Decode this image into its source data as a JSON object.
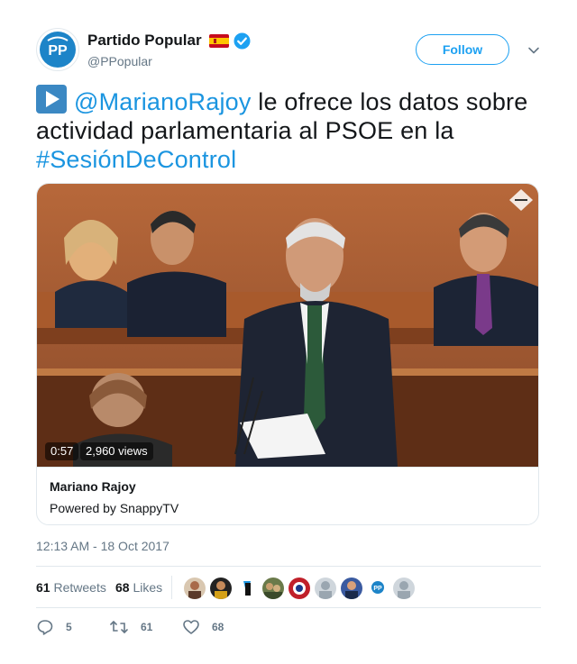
{
  "user": {
    "display_name": "Partido Popular",
    "handle": "@PPopular",
    "avatar_icon": "pp-logo-icon",
    "flag_icon": "spain-flag-icon",
    "verified_icon": "verified-badge-icon"
  },
  "header": {
    "follow_label": "Follow",
    "menu_icon": "chevron-down-icon"
  },
  "tweet": {
    "emoji_icon": "play-button-emoji",
    "mention": "@MarianoRajoy",
    "text_middle": " le ofrece los datos sobre actividad parlamentaria al PSOE en la ",
    "hashtag": "#SesiónDeControl"
  },
  "card": {
    "video_duration": "0:57",
    "video_views": "2,960 views",
    "title": "Mariano Rajoy",
    "subtitle": "Powered by SnappyTV"
  },
  "timestamp": "12:13 AM - 18 Oct 2017",
  "stats": {
    "retweets_count": "61",
    "retweets_label": "Retweets",
    "likes_count": "68",
    "likes_label": "Likes"
  },
  "actions": {
    "reply_count": "5",
    "retweet_count": "61",
    "like_count": "68"
  },
  "colors": {
    "link": "#1b95e0",
    "accent": "#1da1f2",
    "muted": "#657786",
    "border": "#e1e8ed"
  }
}
